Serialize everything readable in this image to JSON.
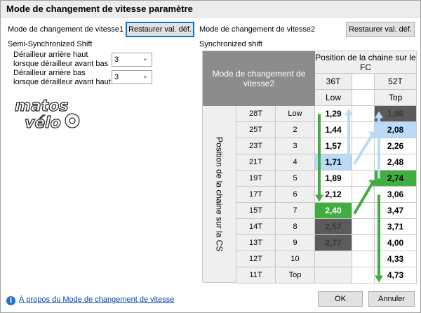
{
  "window": {
    "title": "Mode de changement de vitesse paramètre"
  },
  "left": {
    "mode_label": "Mode de changement de vitesse1",
    "restore_label": "Restaurer val. déf.",
    "subtitle": "Semi-Synchronized Shift",
    "field1_line1": "Dérailleur arrière haut",
    "field1_line2": "lorsque dérailleur avant bas",
    "field1_value": "3",
    "field2_line1": "Dérailleur arrière bas",
    "field2_line2": "lorsque dérailleur avant haut",
    "field2_value": "3",
    "logo_text": "matos vélo"
  },
  "right": {
    "mode_label": "Mode de changement de vitesse2",
    "restore_label": "Restaurer val. déf.",
    "subtitle": "Synchronized shift",
    "table_header": "Mode de changement de vitesse2",
    "fc_header": "Position de la chaine sur le FC",
    "rear_header": "Position de la chaine sur la CS",
    "col36": "36T",
    "col52": "52T",
    "low": "Low",
    "top": "Top"
  },
  "rows": [
    {
      "teeth": "28T",
      "pos": "Low",
      "v36": "1,29",
      "v52": "1,86"
    },
    {
      "teeth": "25T",
      "pos": "2",
      "v36": "1,44",
      "v52": "2,08"
    },
    {
      "teeth": "23T",
      "pos": "3",
      "v36": "1,57",
      "v52": "2,26"
    },
    {
      "teeth": "21T",
      "pos": "4",
      "v36": "1,71",
      "v52": "2,48"
    },
    {
      "teeth": "19T",
      "pos": "5",
      "v36": "1,89",
      "v52": "2,74"
    },
    {
      "teeth": "17T",
      "pos": "6",
      "v36": "2,12",
      "v52": "3,06"
    },
    {
      "teeth": "15T",
      "pos": "7",
      "v36": "2,40",
      "v52": "3,47"
    },
    {
      "teeth": "14T",
      "pos": "8",
      "v36": "2,57",
      "v52": "3,71"
    },
    {
      "teeth": "13T",
      "pos": "9",
      "v36": "2,77",
      "v52": "4,00"
    },
    {
      "teeth": "12T",
      "pos": "10",
      "v36": "",
      "v52": "4,33"
    },
    {
      "teeth": "11T",
      "pos": "Top",
      "v36": "",
      "v52": "4,73"
    }
  ],
  "colors": {
    "green": "#3fae3f",
    "blue": "#b9dbf7",
    "dark": "#5b5b5b",
    "darker": "#666666"
  },
  "footer": {
    "about_link": "À propos du Mode de changement de vitesse",
    "ok_label": "OK",
    "cancel_label": "Annuler"
  }
}
